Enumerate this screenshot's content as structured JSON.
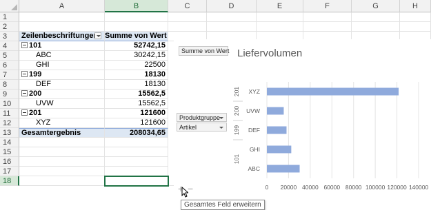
{
  "columns": [
    "A",
    "B",
    "C",
    "D",
    "E",
    "F",
    "G",
    "H"
  ],
  "rows": [
    "1",
    "2",
    "3",
    "4",
    "5",
    "6",
    "7",
    "8",
    "9",
    "10",
    "11",
    "12",
    "13",
    "14",
    "15",
    "16",
    "17",
    "18"
  ],
  "pivot": {
    "header_label": "Zeilenbeschriftungen",
    "header_value": "Summe von Wert",
    "entries": [
      {
        "label": "101",
        "value": "52742,15",
        "level": 0
      },
      {
        "label": "ABC",
        "value": "30242,15",
        "level": 1
      },
      {
        "label": "GHI",
        "value": "22500",
        "level": 1
      },
      {
        "label": "199",
        "value": "18130",
        "level": 0
      },
      {
        "label": "DEF",
        "value": "18130",
        "level": 1
      },
      {
        "label": "200",
        "value": "15562,5",
        "level": 0
      },
      {
        "label": "UVW",
        "value": "15562,5",
        "level": 1
      },
      {
        "label": "201",
        "value": "121600",
        "level": 0
      },
      {
        "label": "XYZ",
        "value": "121600",
        "level": 1
      }
    ],
    "total_label": "Gesamtergebnis",
    "total_value": "208034,65"
  },
  "chart": {
    "value_field_button": "Summe von Wert",
    "row_field_buttons": [
      "Produktgruppe",
      "Artikel"
    ],
    "expand_label": "+",
    "collapse_label": "−",
    "tooltip": "Gesamtes Feld erweitern",
    "bar_color": "#8faadc"
  },
  "chart_data": {
    "type": "bar",
    "orientation": "horizontal",
    "title": "Liefervolumen",
    "groups": [
      {
        "name": "201",
        "categories": [
          "XYZ"
        ],
        "values": [
          121600
        ]
      },
      {
        "name": "200",
        "categories": [
          "UVW"
        ],
        "values": [
          15562.5
        ]
      },
      {
        "name": "199",
        "categories": [
          "DEF"
        ],
        "values": [
          18130
        ]
      },
      {
        "name": "101",
        "categories": [
          "GHI",
          "ABC"
        ],
        "values": [
          22500,
          30242.15
        ]
      }
    ],
    "xlim": [
      0,
      140000
    ],
    "xticks": [
      "0",
      "20000",
      "40000",
      "60000",
      "80000",
      "100000",
      "120000",
      "140000"
    ],
    "grid": true
  }
}
